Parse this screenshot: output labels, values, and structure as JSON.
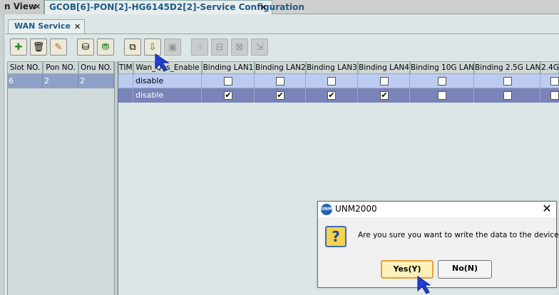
{
  "top_tabs": [
    {
      "label": "n View",
      "close": "✕"
    },
    {
      "label": "GCOB[6]-PON[2]-HG6145D2[2]-Service Configuration",
      "close": "✕"
    }
  ],
  "sub_tab": {
    "label": "WAN Service",
    "close": "✕"
  },
  "toolbar": [
    {
      "icon": "add-icon",
      "glyph": "✚"
    },
    {
      "icon": "delete-icon",
      "glyph": "🗑"
    },
    {
      "icon": "edit-icon",
      "glyph": "✎"
    },
    {
      "icon": "read-db-icon",
      "glyph": "⛁"
    },
    {
      "icon": "save-db-icon",
      "glyph": "⛃"
    },
    {
      "icon": "read-device-icon",
      "glyph": "⧉"
    },
    {
      "icon": "write-device-icon",
      "glyph": "⇩"
    },
    {
      "icon": "disabled-tool-icon-1",
      "glyph": "▣"
    },
    {
      "icon": "disabled-tool-icon-2",
      "glyph": "☝"
    },
    {
      "icon": "disabled-tool-icon-3",
      "glyph": "⊟"
    },
    {
      "icon": "disabled-tool-icon-4",
      "glyph": "⊠"
    },
    {
      "icon": "disabled-tool-icon-5",
      "glyph": "⇲"
    }
  ],
  "left_table": {
    "headers": [
      "Slot NO.",
      "Pon NO.",
      "Onu NO."
    ],
    "row": [
      "6",
      "2",
      "2"
    ]
  },
  "right_table": {
    "headers": [
      "TIME",
      "Wan_Qos_Enable",
      "Binding LAN1",
      "Binding LAN2",
      "Binding LAN3",
      "Binding LAN4",
      "Binding 10G LAN",
      "Binding 2.5G LAN",
      "2.4G"
    ],
    "rows": [
      {
        "wan_qos": "disable",
        "lan1": false,
        "lan2": false,
        "lan3": false,
        "lan4": false,
        "lan10g": false,
        "lan25g": false
      },
      {
        "wan_qos": "disable",
        "lan1": true,
        "lan2": true,
        "lan3": true,
        "lan4": true,
        "lan10g": false,
        "lan25g": false
      }
    ],
    "check_glyph": "✔"
  },
  "dialog": {
    "title": "UNM2000",
    "logo": "UNM",
    "close": "✕",
    "message": "Are you sure you want to write the data to the device?",
    "yes_label": "Yes(Y)",
    "no_label": "No(N)",
    "question_glyph": "?"
  },
  "colors": {
    "selection_row": "#7a84b8",
    "accent": "#1f5a86"
  }
}
